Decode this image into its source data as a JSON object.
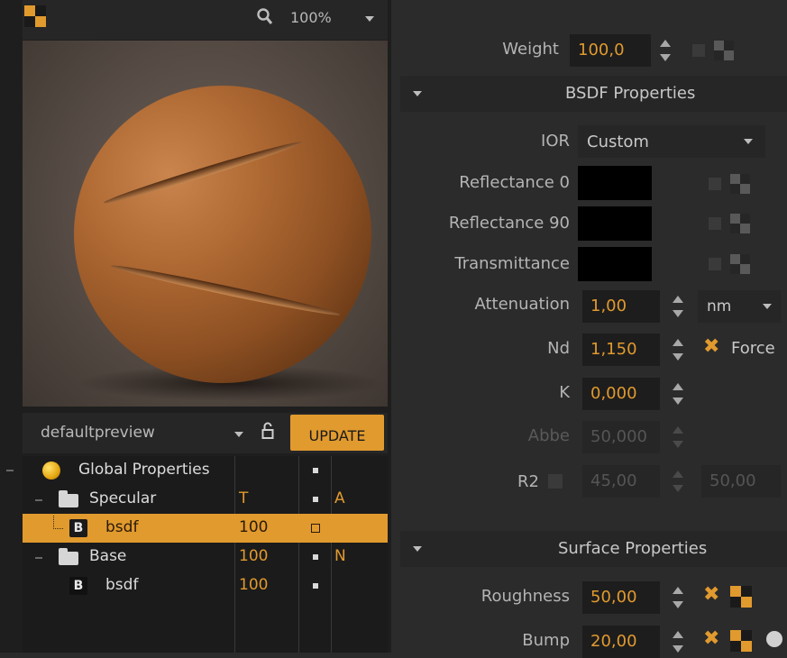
{
  "preview": {
    "zoom": "100%",
    "scene_dropdown": "defaultpreview",
    "update_label": "UPDATE"
  },
  "tree": {
    "rows": [
      {
        "name": "Global Properties",
        "col1": "",
        "col2": "",
        "col3": ""
      },
      {
        "name": "Specular",
        "col1": "T",
        "col2": "",
        "col3": "A"
      },
      {
        "name": "bsdf",
        "badge": "B",
        "col1": "100",
        "col2": "",
        "col3": ""
      },
      {
        "name": "Base",
        "col1": "100",
        "col2": "",
        "col3": "N"
      },
      {
        "name": "bsdf",
        "badge": "B",
        "col1": "100",
        "col2": "",
        "col3": ""
      }
    ]
  },
  "props": {
    "weight": {
      "label": "Weight",
      "value": "100,0"
    },
    "bsdf_section": "BSDF Properties",
    "ior": {
      "label": "IOR",
      "value": "Custom"
    },
    "reflectance0": {
      "label": "Reflectance 0"
    },
    "reflectance90": {
      "label": "Reflectance 90"
    },
    "transmittance": {
      "label": "Transmittance"
    },
    "attenuation": {
      "label": "Attenuation",
      "value": "1,00",
      "unit": "nm"
    },
    "nd": {
      "label": "Nd",
      "value": "1,150",
      "force_label": "Force"
    },
    "k": {
      "label": "K",
      "value": "0,000"
    },
    "abbe": {
      "label": "Abbe",
      "value": "50,000"
    },
    "r2": {
      "label": "R2",
      "value1": "45,00",
      "value2": "50,00"
    },
    "surface_section": "Surface Properties",
    "roughness": {
      "label": "Roughness",
      "value": "50,00"
    },
    "bump": {
      "label": "Bump",
      "value": "20,00"
    }
  },
  "colors": {
    "accent": "#e19a2e",
    "panel": "#2b2b2b",
    "field_bg": "#1d1d1d"
  }
}
